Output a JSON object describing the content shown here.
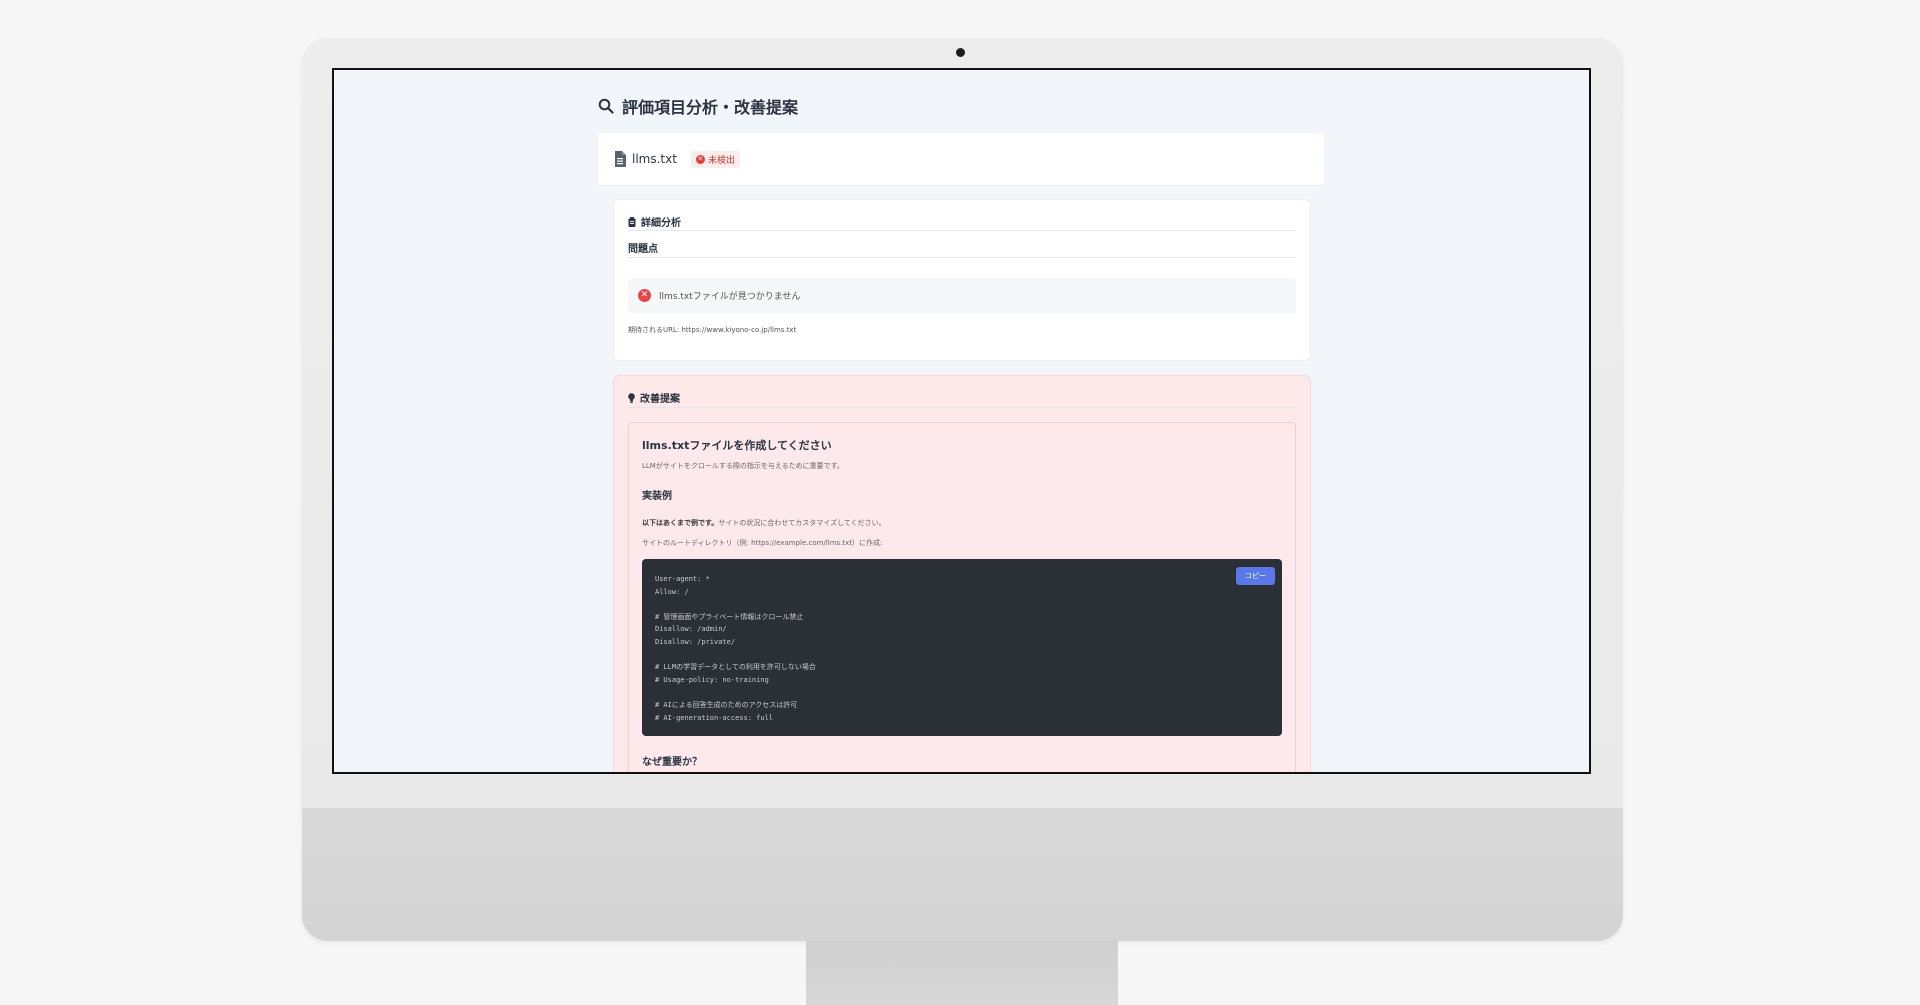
{
  "page": {
    "title": "評価項目分析・改善提案",
    "title_icon": "search-icon"
  },
  "file": {
    "name": "llms.txt",
    "icon": "file-icon",
    "status_label": "未検出",
    "status_color": "#e23c3c"
  },
  "analysis": {
    "heading": "詳細分析",
    "problems_heading": "問題点",
    "issue_text": "llms.txtファイルが見つかりません",
    "expected_url": "期待されるURL: https://www.kiyono-co.jp/llms.txt"
  },
  "suggestion": {
    "heading": "改善提案",
    "title": "llms.txtファイルを作成してください",
    "description": "LLMがサイトをクロールする際の指示を与えるために重要です。",
    "example_heading": "実装例",
    "note_bold": "以下はあくまで例です。",
    "note_rest": "サイトの状況に合わせてカスタマイズしてください。",
    "root_note": "サイトのルートディレクトリ（例: https://example.com/llms.txt）に作成:",
    "copy_label": "コピー",
    "code_lines": [
      "User-agent: *",
      "Allow: /",
      "",
      "# 管理画面やプライベート情報はクロール禁止",
      "Disallow: /admin/",
      "Disallow: /private/",
      "",
      "# LLMの学習データとしての利用を許可しない場合",
      "# Usage-policy: no-training",
      "",
      "# AIによる回答生成のためのアクセスは許可",
      "# AI-generation-access: full"
    ],
    "why_heading": "なぜ重要か？"
  },
  "colors": {
    "suggestion_bg": "#fde8ea",
    "code_bg": "#2b2f36",
    "copy_button": "#5b78e8"
  }
}
